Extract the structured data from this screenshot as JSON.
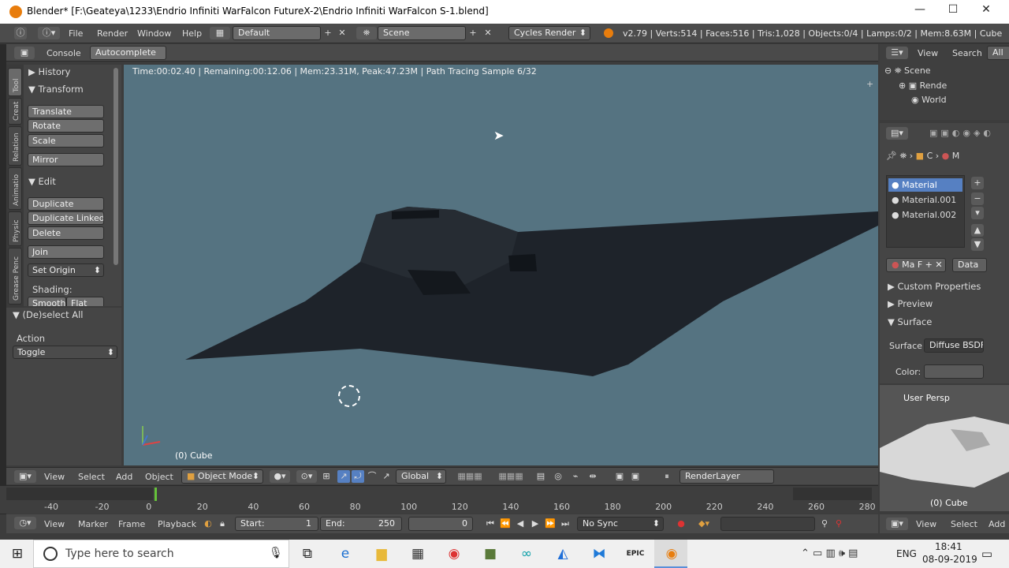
{
  "window": {
    "title": "Blender* [F:\\Geateya\\1233\\Endrio Infiniti WarFalcon FutureX-2\\Endrio Infiniti WarFalcon S-1.blend]",
    "minimize": "—",
    "maximize": "☐",
    "close": "✕"
  },
  "info": {
    "menus": [
      "File",
      "Render",
      "Window",
      "Help"
    ],
    "layout": "Default",
    "scene": "Scene",
    "engine": "Cycles Render",
    "stats": "v2.79 | Verts:514 | Faces:516 | Tris:1,028 | Objects:0/4 | Lamps:0/2 | Mem:8.63M | Cube"
  },
  "console": {
    "console_label": "Console",
    "autocomplete_label": "Autocomplete"
  },
  "tabs": [
    "Tool",
    "Creat",
    "Relation",
    "Animatio",
    "Physic",
    "Grease Penc"
  ],
  "toolshelf": {
    "history": "History",
    "transform": "Transform",
    "translate": "Translate",
    "rotate": "Rotate",
    "scale": "Scale",
    "mirror": "Mirror",
    "edit": "Edit",
    "duplicate": "Duplicate",
    "duplicate_linked": "Duplicate Linked",
    "delete": "Delete",
    "join": "Join",
    "set_origin": "Set Origin",
    "shading": "Shading:",
    "smooth": "Smooth",
    "flat": "Flat"
  },
  "redo": {
    "title": "(De)select All",
    "action_label": "Action",
    "action_value": "Toggle"
  },
  "viewport": {
    "render_status": "Time:00:02.40 | Remaining:00:12.06 | Mem:23.31M, Peak:47.23M | Path Tracing Sample 6/32",
    "object_label": "(0) Cube"
  },
  "vp_header": {
    "view": "View",
    "select": "Select",
    "add": "Add",
    "object": "Object",
    "mode": "Object Mode",
    "orientation": "Global",
    "render_layer": "RenderLayer"
  },
  "timeline": {
    "ticks": [
      "-40",
      "-20",
      "0",
      "20",
      "40",
      "60",
      "80",
      "100",
      "120",
      "140",
      "160",
      "180",
      "200",
      "220",
      "240",
      "260",
      "280"
    ],
    "current_frame_fraction": 0.115
  },
  "tl_header": {
    "view": "View",
    "marker": "Marker",
    "frame": "Frame",
    "playback": "Playback",
    "start_label": "Start:",
    "start": "1",
    "end_label": "End:",
    "end": "250",
    "current": "0",
    "sync": "No Sync"
  },
  "outliner": {
    "view": "View",
    "search": "Search",
    "all": "All",
    "items": [
      "Scene",
      "Rende",
      "World"
    ]
  },
  "props": {
    "context": "C",
    "material_ctx": "M",
    "materials": [
      "Material",
      "Material.001",
      "Material.002"
    ],
    "mat_name": "Ma",
    "mat_f": "F",
    "data": "Data",
    "custom_props": "Custom Properties",
    "preview": "Preview",
    "surface": "Surface",
    "surface_label": "Surface",
    "surface_value": "Diffuse BSDF",
    "color_label": "Color:"
  },
  "thumb": {
    "persp": "User Persp",
    "object": "(0) Cube"
  },
  "rhead": {
    "view": "View",
    "select": "Select",
    "add": "Add"
  },
  "taskbar": {
    "search_placeholder": "Type here to search",
    "lang": "ENG",
    "time": "18:41",
    "date": "08-09-2019"
  },
  "colors": {
    "viewport_bg": "#557381",
    "selected_material": "#5680c2",
    "taskbar": "#f0f0f0"
  }
}
